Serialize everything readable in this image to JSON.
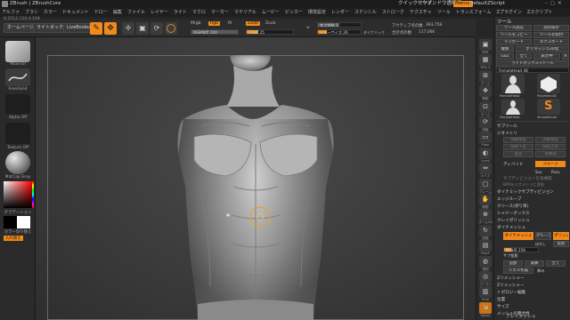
{
  "title_bar": {
    "app_title": "ZBrush | ZBrushCore",
    "quicksave": "クイックセーブ",
    "transparency": "ウィンドウ透明度",
    "menus_label": "Menus",
    "script": "DefaultZScript"
  },
  "menu_bar": [
    "アルファ",
    "ブラシ",
    "カラー",
    "ドキュメント",
    "ドロー",
    "編集",
    "ファイル",
    "レイヤー",
    "ライト",
    "マクロ",
    "マーカー",
    "マテリアル",
    "ムービー",
    "ピッカー",
    "環境設定",
    "レンダー",
    "ステンシル",
    "ストローク",
    "テクスチャ",
    "ツール",
    "トランスフォーム",
    "Zプラグイン",
    "Zスクリプト"
  ],
  "info_text": "0.2512,110.4,104",
  "top_shelf": {
    "homepage": "ホームページ",
    "lightbox": "ライトボックス",
    "live_boolean": "LiveBoolean",
    "edit": "編集",
    "draw": "ドロー",
    "mrgb": "Mrgb",
    "rgb": "Rgb",
    "m": "M",
    "zadd": "Zadd",
    "zsub": "Zsub",
    "rgb_intensity_label": "RGB強度",
    "rgb_intensity_value": "100",
    "z_intensity_label": "Z強度",
    "z_intensity_value": "25",
    "focal_shift_label": "焦点移動",
    "focal_shift_value": "0",
    "draw_size_label": "ドローサイズ",
    "draw_size_value": "26",
    "dynamic": "ダイナミック",
    "active_points_label": "アクティブ点の数",
    "active_points_value": "393,758",
    "total_points_label": "合計点の数",
    "total_points_value": "117,066"
  },
  "left_shelf": {
    "brush_name": "MoveTol",
    "stroke_name": "FreeHand",
    "alpha_name": "Alpha Off",
    "texture_name": "Texture Off",
    "material_name": "MatCap Gray",
    "gradient_label": "グラデーション",
    "color_switch_label": "カラー切り替え",
    "swap_label": "入れ替え"
  },
  "right_shelf": [
    {
      "icon": "▣",
      "cap": "BPR"
    },
    {
      "icon": "▦",
      "cap": "SPix 3"
    },
    {
      "icon": "⊞",
      "cap": "ズーム"
    },
    {
      "icon": "✥",
      "cap": "移動"
    },
    {
      "icon": "⊡",
      "cap": "ズーム"
    },
    {
      "icon": "⟳",
      "cap": "回転"
    },
    {
      "icon": "▭",
      "cap": "Floor"
    },
    {
      "icon": "◐",
      "cap": "Local"
    },
    {
      "icon": "⇔",
      "cap": "X Y Z"
    },
    {
      "icon": "▢",
      "cap": "フレーム"
    },
    {
      "icon": "✋",
      "cap": "移動"
    },
    {
      "icon": "⊕",
      "cap": "ズーム3D"
    },
    {
      "icon": "↻",
      "cap": "回転"
    },
    {
      "icon": "▤",
      "cap": "PolyF"
    },
    {
      "icon": "◍",
      "cap": "透明"
    },
    {
      "icon": "◎",
      "cap": "ゴースト"
    },
    {
      "icon": "▥",
      "cap": "Solo"
    },
    {
      "icon": "⇲",
      "cap": "Xpose"
    }
  ],
  "tool_panel": {
    "title": "ツール",
    "load_tool": "ツール読込",
    "save_as": "別名保存",
    "load_from_project": "ツールをコピー",
    "paste": "ツールを貼付",
    "import": "インポート",
    "export": "エクスポート",
    "clone": "複製",
    "polymesh3d": "ポリメッシュ3D化",
    "goz": "GoZ",
    "all": "全て",
    "visible": "表示中",
    "r": "R",
    "lightbox_tools": "ライトボックス→ツール",
    "current_tool_label": "FemaleHead",
    "current_tool_value": "48",
    "thumbs": [
      "FemaleHead",
      "PolyMesh3D",
      "FemaleHead",
      "SimpleBrush"
    ],
    "subtool": "サブツール",
    "geometry": "ジオメトリ",
    "lower_res": "低解像度",
    "higher_res": "高解像度",
    "del_lower": "削除下位",
    "del_higher": "削除上位",
    "freeze": "固定",
    "reconstruct": "再構築",
    "subdivide": "ディバイド",
    "smt": "スムーズ",
    "suv": "Suv",
    "rsuv": "Rsuv",
    "subdiv_levels": "サブディビジョンを再構築",
    "convert_bpr": "BPRをジオメトリに変換",
    "dynamic_subdiv": "ダイナミックサブディビジョン",
    "edge_loop": "エッジループ",
    "crease": "クリース(折り目)",
    "shadow_box": "シャドーボックス",
    "clay_polish": "クレイポリッシュ",
    "dynamesh": "ダイナメッシュ",
    "dynamesh_btn": "ダイナメッシュ",
    "groups": "グループ",
    "polish": "ポリッシュ",
    "blur": "ぼかし",
    "project": "投影",
    "resolution_label": "解像度",
    "resolution_value": "256",
    "subproject": "サブ投影",
    "add": "追加",
    "sub": "減算",
    "remesh_all": "全て",
    "shell": "シェル作成",
    "thickness": "厚み",
    "zremesher": "Zリメッシャー",
    "topology": "トポロジー編集",
    "position": "位置",
    "size": "サイズ",
    "mesh_integrity": "メッシュの整合性",
    "array_mesh": "アレイメッシュ"
  },
  "colors": {
    "accent": "#f28a1a",
    "panel_bg": "#2b2b2b",
    "viewport_bg": "#3b3b3b"
  }
}
